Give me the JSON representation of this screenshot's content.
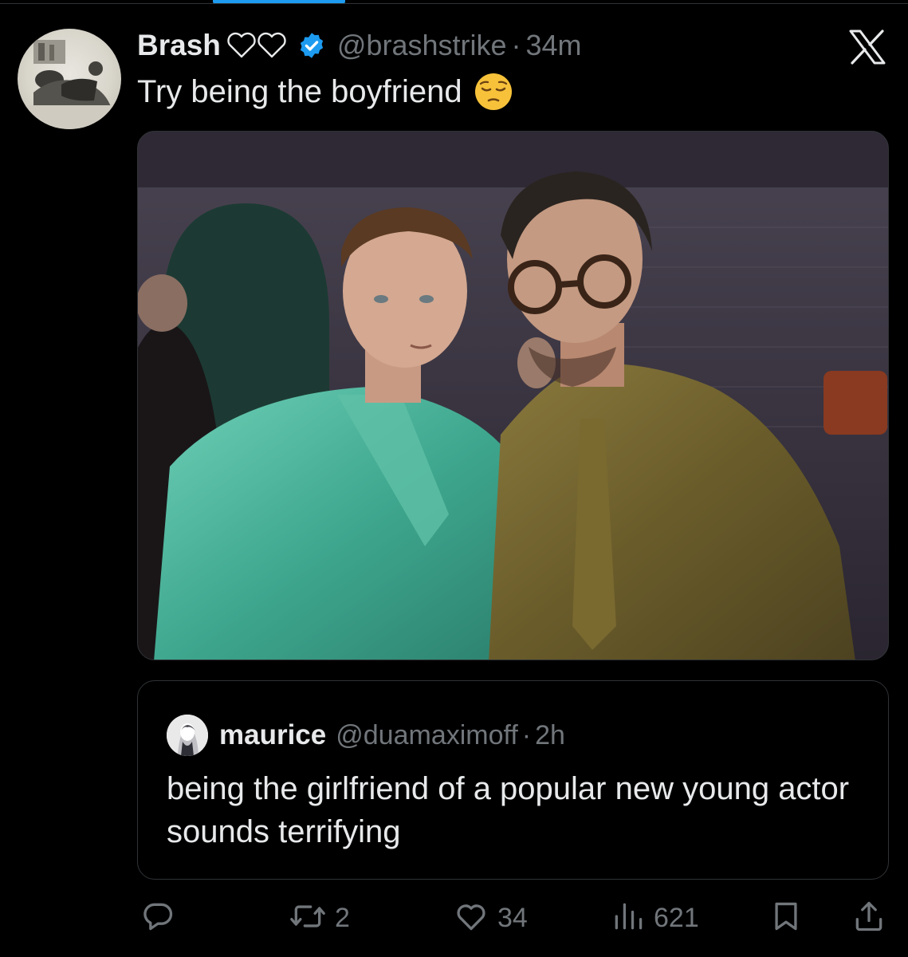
{
  "tweet": {
    "author_name": "Brash",
    "name_hearts": "♡♡",
    "handle": "@brashstrike",
    "separator": "·",
    "time": "34m",
    "text": "Try being the boyfriend",
    "emoji": "pensive-face",
    "close_icon": "x-logo-icon",
    "verified_color": "#1d9bf0"
  },
  "quote": {
    "author_name": "maurice",
    "handle": "@duamaximoff",
    "separator": "·",
    "time": "2h",
    "text": "being the girlfriend of a popular new young actor sounds terrifying"
  },
  "actions": {
    "reply": {
      "icon": "reply-icon",
      "count": ""
    },
    "retweet": {
      "icon": "retweet-icon",
      "count": "2"
    },
    "like": {
      "icon": "heart-icon",
      "count": "34"
    },
    "views": {
      "icon": "views-icon",
      "count": "621"
    },
    "bookmark": {
      "icon": "bookmark-icon"
    },
    "share": {
      "icon": "share-icon"
    }
  },
  "colors": {
    "background": "#000000",
    "text_primary": "#e7e9ea",
    "text_secondary": "#71767b",
    "accent": "#1d9bf0",
    "border": "#2f3336"
  }
}
